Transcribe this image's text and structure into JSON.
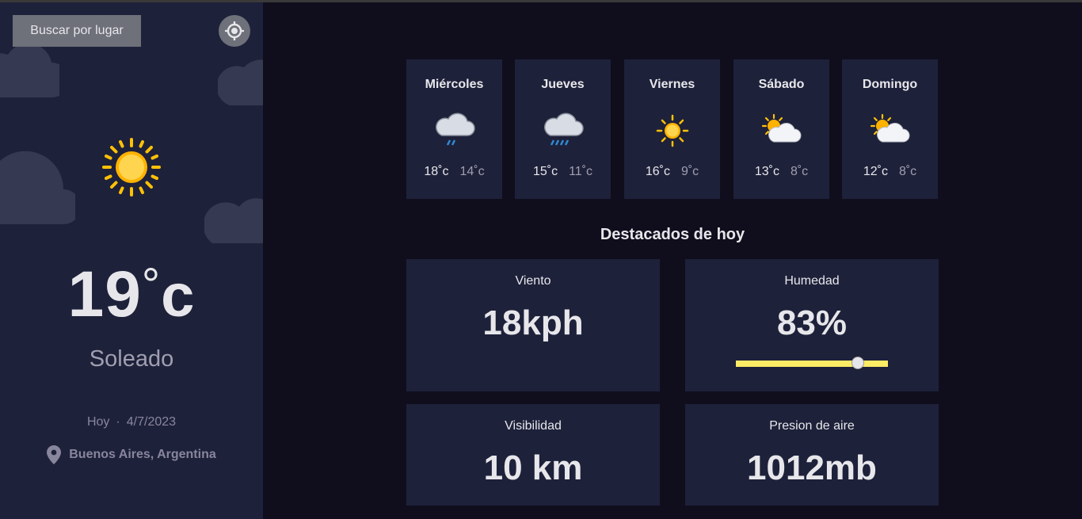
{
  "sidebar": {
    "search_label": "Buscar por lugar",
    "current_icon": "sun-icon",
    "temperature": "19",
    "degree": "°",
    "unit": "c",
    "condition": "Soleado",
    "today_label": "Hoy",
    "date_sep": "·",
    "date": "4/7/2023",
    "location": "Buenos Aires, Argentina"
  },
  "forecast": [
    {
      "day": "Miércoles",
      "max": "18˚c",
      "min": "14˚c",
      "icon": "light-rain-icon"
    },
    {
      "day": "Jueves",
      "max": "15˚c",
      "min": "11˚c",
      "icon": "heavy-rain-icon"
    },
    {
      "day": "Viernes",
      "max": "16˚c",
      "min": "9˚c",
      "icon": "sun-icon"
    },
    {
      "day": "Sábado",
      "max": "13˚c",
      "min": "8˚c",
      "icon": "partly-cloudy-icon"
    },
    {
      "day": "Domingo",
      "max": "12˚c",
      "min": "8˚c",
      "icon": "partly-cloudy-icon"
    }
  ],
  "highlights": {
    "title": "Destacados de hoy",
    "wind": {
      "label": "Viento",
      "value": "18kph"
    },
    "humidity": {
      "label": "Humedad",
      "value": "83%",
      "level": 0.8
    },
    "visibility": {
      "label": "Visibilidad",
      "value": "10 km"
    },
    "pressure": {
      "label": "Presion de aire",
      "value": "1012mb"
    }
  },
  "colors": {
    "background": "#100e1d",
    "panel": "#1e213a",
    "humidity_bar": "#ffec65",
    "sun": "#ffc107"
  }
}
